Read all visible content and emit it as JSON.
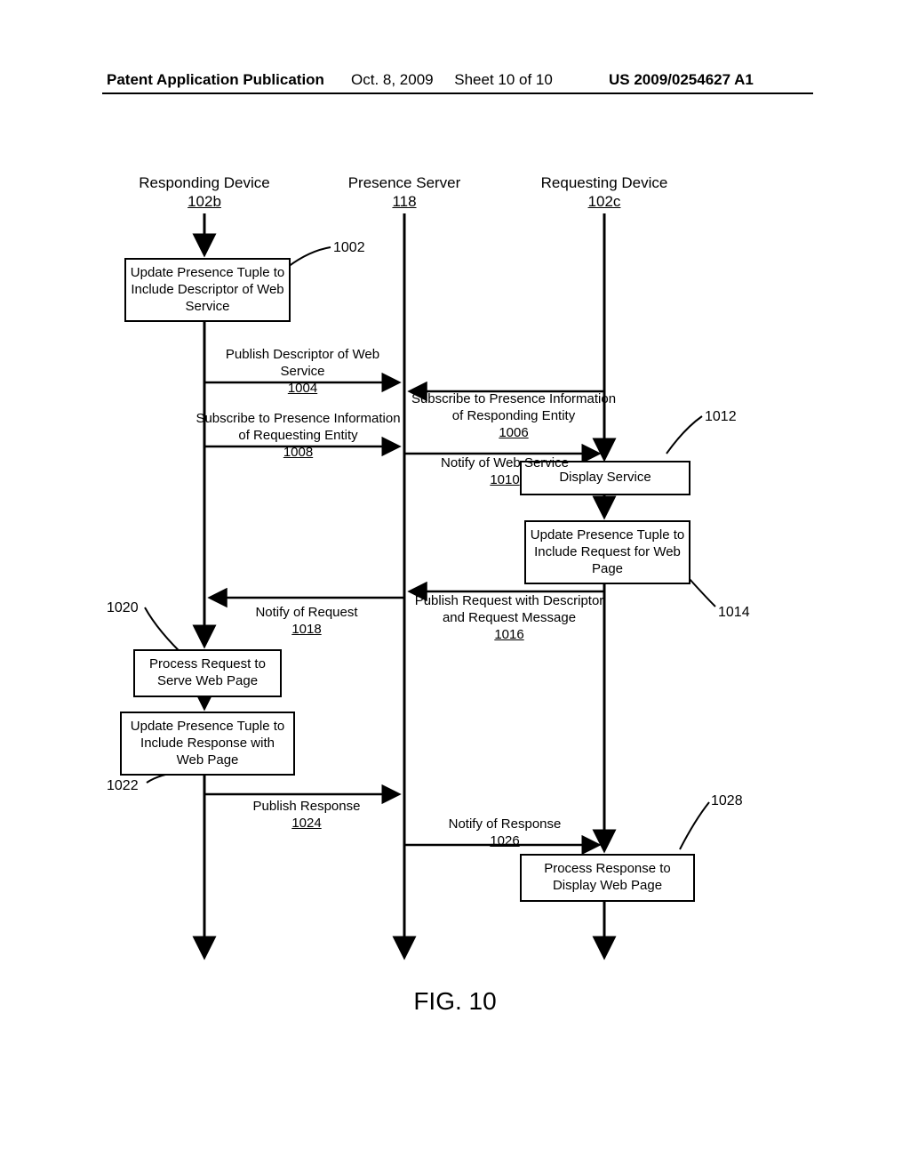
{
  "header": {
    "left": "Patent Application Publication",
    "center_date": "Oct. 8, 2009",
    "center_sheet": "Sheet 10 of 10",
    "right": "US 2009/0254627 A1"
  },
  "lanes": {
    "responding": {
      "title": "Responding Device",
      "ref": "102b"
    },
    "presence": {
      "title": "Presence Server",
      "ref": "118"
    },
    "requesting": {
      "title": "Requesting Device",
      "ref": "102c"
    }
  },
  "boxes": {
    "b1002": "Update Presence Tuple to Include Descriptor of Web Service",
    "b1012": "Display Service",
    "b1014": "Update Presence Tuple to Include Request for Web Page",
    "b1020": "Process Request to Serve Web Page",
    "b1022": "Update Presence Tuple to Include Response with Web Page",
    "b1028": "Process Response to Display Web Page"
  },
  "messages": {
    "m1004": {
      "text": "Publish Descriptor of Web Service",
      "ref": "1004"
    },
    "m1006": {
      "text": "Subscribe to Presence Information of Responding Entity",
      "ref": "1006"
    },
    "m1008": {
      "text": "Subscribe to Presence Information of Requesting Entity",
      "ref": "1008"
    },
    "m1010": {
      "text": "Notify of Web Service",
      "ref": "1010"
    },
    "m1016": {
      "text": "Publish Request with Descriptor and Request Message",
      "ref": "1016"
    },
    "m1018": {
      "text": "Notify of Request",
      "ref": "1018"
    },
    "m1024": {
      "text": "Publish Response",
      "ref": "1024"
    },
    "m1026": {
      "text": "Notify of Response",
      "ref": "1026"
    }
  },
  "labels": {
    "l1002": "1002",
    "l1012": "1012",
    "l1014": "1014",
    "l1020": "1020",
    "l1022": "1022",
    "l1028": "1028"
  },
  "figure_title": "FIG. 10"
}
